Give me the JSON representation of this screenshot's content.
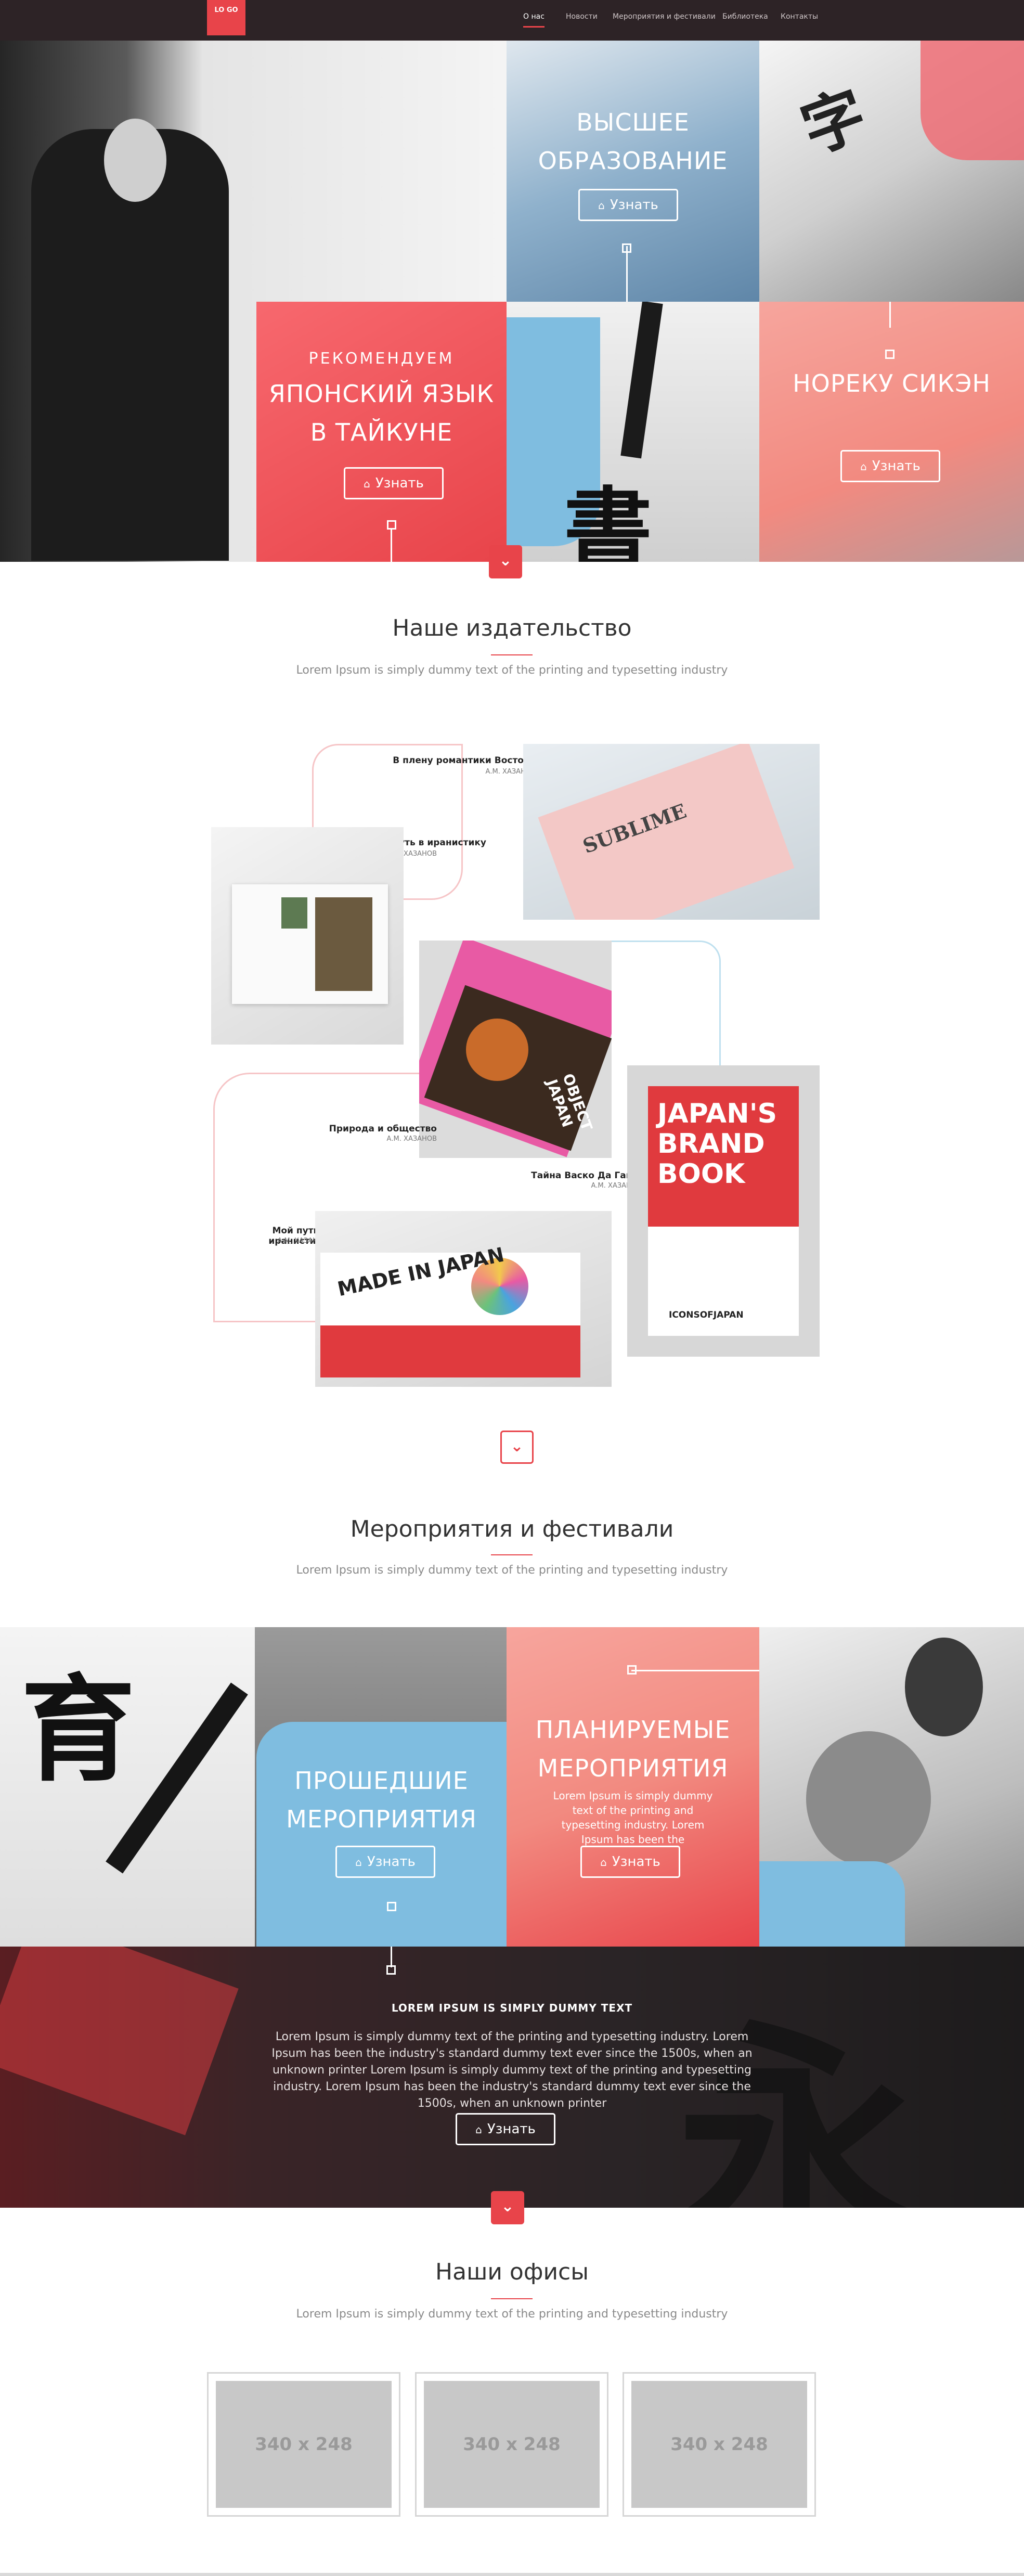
{
  "nav": {
    "logo": "LO GO",
    "items": [
      "О нас",
      "Новости",
      "Мероприятия и фестивали",
      "Библиотека",
      "Контакты"
    ]
  },
  "hero": {
    "tile_higher": {
      "title": "ВЫСШЕЕ ОБРАЗОВАНИЕ",
      "button": "Узнать"
    },
    "tile_featured": {
      "sub": "РЕКОМЕНДУЕМ",
      "title": "ЯПОНСКИЙ ЯЗЫК В ТАЙКУНЕ",
      "button": "Узнать"
    },
    "tile_noreku": {
      "title": "НОРЕКУ СИКЭН",
      "button": "Узнать"
    }
  },
  "publishing": {
    "title": "Наше издательство",
    "subtitle": "Lorem Ipsum is simply dummy text of the printing and typesetting industry",
    "books": [
      {
        "title": "В плену романтики Востока",
        "author": "А.М. ХАЗАНОВ"
      },
      {
        "title": "Мой путь в иранистику",
        "author": "А.М. ХАЗАНОВ"
      },
      {
        "title": "Природа и общество",
        "author": "А.М. ХАЗАНОВ"
      },
      {
        "title": "Тайна Васко Да Гамы",
        "author": "А.М. ХАЗАНОВ"
      },
      {
        "title": "Мой путь в иранистику",
        "author": "А.М. ХАЗАНОВ"
      }
    ],
    "covers": {
      "sublime": "SUBLIME",
      "object_japan": "OBJECT JAPAN",
      "brand_book": "JAPAN'S BRAND BOOK",
      "icons": "ICONSOFJAPAN",
      "made_in_japan": "MADE IN JAPAN"
    }
  },
  "events": {
    "title": "Мероприятия и фестивали",
    "subtitle": "Lorem Ipsum is simply dummy text of the printing and typesetting industry",
    "past": {
      "title": "ПРОШЕДШИЕ МЕРОПРИЯТИЯ",
      "button": "Узнать"
    },
    "planned": {
      "title": "ПЛАНИРУЕМЫЕ МЕРОПРИЯТИЯ",
      "text": "Lorem Ipsum is simply dummy text of the printing and typesetting industry. Lorem Ipsum has been the",
      "button": "Узнать"
    }
  },
  "banner": {
    "title": "LOREM IPSUM IS SIMPLY DUMMY TEXT",
    "text": "Lorem Ipsum is simply dummy text of the printing and typesetting industry. Lorem Ipsum has been the industry's standard dummy text ever since the 1500s, when an unknown printer Lorem Ipsum is simply dummy text of the printing and typesetting industry. Lorem Ipsum has been the industry's standard dummy text ever since the 1500s, when an unknown printer",
    "button": "Узнать"
  },
  "offices": {
    "title": "Наши офисы",
    "subtitle": "Lorem Ipsum is simply dummy text of the printing and typesetting industry",
    "placeholders": [
      "340 x 248",
      "340 x 248",
      "340 x 248"
    ]
  },
  "colors": {
    "accent": "#e8444a",
    "dark": "#2d2326",
    "blue": "#7fbde0",
    "salmon": "#f28a80"
  },
  "icons": {
    "button": "home-icon",
    "chevron": "chevron-down-icon"
  }
}
